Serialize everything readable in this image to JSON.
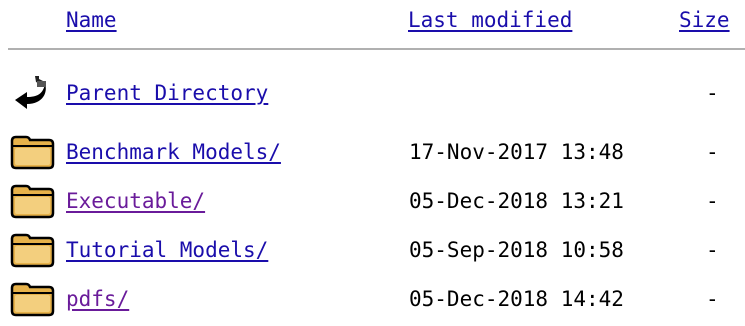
{
  "header": {
    "name_label": "Name",
    "modified_label": "Last modified",
    "size_label": "Size"
  },
  "rows": [
    {
      "icon": "back-arrow-icon",
      "name": "Parent Directory",
      "modified": "",
      "size": "-"
    },
    {
      "icon": "folder-icon",
      "name": "Benchmark Models/",
      "modified": "17-Nov-2017 13:48",
      "size": "-"
    },
    {
      "icon": "folder-icon",
      "name": "Executable/",
      "modified": "05-Dec-2018 13:21",
      "size": "-"
    },
    {
      "icon": "folder-icon",
      "name": "Tutorial Models/",
      "modified": "05-Sep-2018 10:58",
      "size": "-"
    },
    {
      "icon": "folder-icon",
      "name": "pdfs/",
      "modified": "05-Dec-2018 14:42",
      "size": "-"
    }
  ],
  "colors": {
    "link": "#1a0dab",
    "visited_link": "#6a1b9a",
    "folder_fill": "#f0c060",
    "rule": "#b0b0b0"
  }
}
